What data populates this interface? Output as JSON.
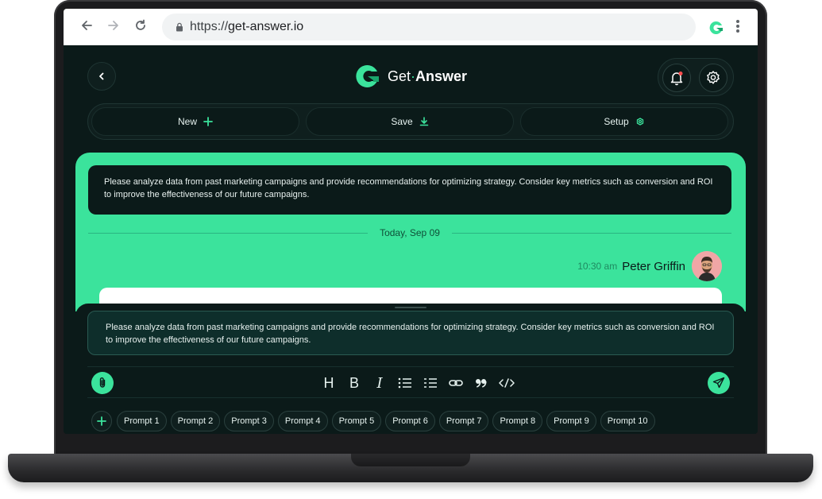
{
  "browser": {
    "url_scheme": "https://",
    "url_host": "get-answer.io"
  },
  "app": {
    "logo_text_prefix": "Get",
    "logo_dot": "·",
    "logo_text_suffix": "Answer",
    "accent_color": "#3be39c",
    "background_color": "#0b1a19"
  },
  "actions": [
    {
      "label": "New",
      "icon": "plus-icon"
    },
    {
      "label": "Save",
      "icon": "download-icon"
    },
    {
      "label": "Setup",
      "icon": "gear-icon"
    }
  ],
  "chat": {
    "prompt_text": "Please analyze data from past marketing campaigns and provide recommendations for optimizing strategy. Consider key metrics such as conversion and ROI to improve the effectiveness of our future campaigns.",
    "date_separator": "Today, Sep 09",
    "message_time": "10:30 am",
    "message_author": "Peter Griffin"
  },
  "composer": {
    "input_value": "Please analyze data from past marketing campaigns and provide recommendations for optimizing strategy. Consider key metrics such as conversion and ROI to improve the effectiveness of our future campaigns.",
    "format_tools": [
      {
        "label": "H",
        "icon": "heading-icon"
      },
      {
        "label": "B",
        "icon": "bold-icon"
      },
      {
        "label": "I",
        "icon": "italic-icon"
      }
    ]
  },
  "prompts": [
    "Prompt 1",
    "Prompt 2",
    "Prompt 3",
    "Prompt 4",
    "Prompt 5",
    "Prompt 6",
    "Prompt 7",
    "Prompt 8",
    "Prompt 9",
    "Prompt 10"
  ]
}
